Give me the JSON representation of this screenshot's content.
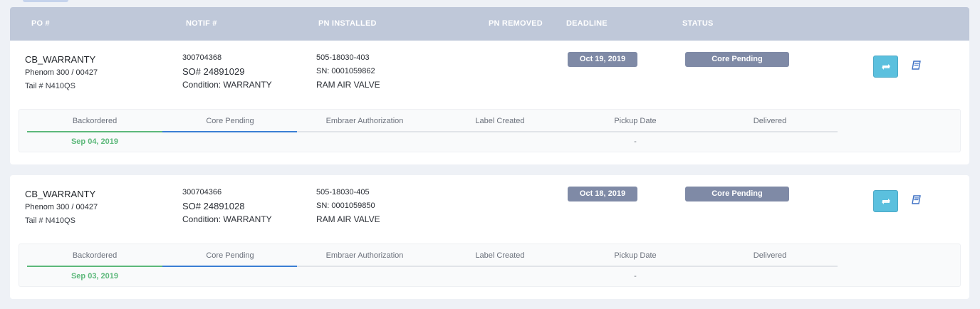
{
  "header": {
    "po": "PO #",
    "notif": "NOTIF #",
    "pn_installed": "PN INSTALLED",
    "pn_removed": "PN REMOVED",
    "deadline": "DEADLINE",
    "status": "STATUS"
  },
  "steps": [
    "Backordered",
    "Core Pending",
    "Embraer Authorization",
    "Label Created",
    "Pickup Date",
    "Delivered"
  ],
  "orders": [
    {
      "po": "CB_WARRANTY",
      "aircraft": "Phenom 300 / 00427",
      "tail": "Tail # N410QS",
      "notif": "300704368",
      "so": "SO# 24891029",
      "condition": "Condition: WARRANTY",
      "pn": "505-18030-403",
      "sn": "SN: 0001059862",
      "description": "RAM AIR VALVE",
      "deadline": "Oct 19, 2019",
      "status": "Core Pending",
      "backordered_date": "Sep 04, 2019",
      "pickup_date": "-"
    },
    {
      "po": "CB_WARRANTY",
      "aircraft": "Phenom 300 / 00427",
      "tail": "Tail # N410QS",
      "notif": "300704366",
      "so": "SO# 24891028",
      "condition": "Condition: WARRANTY",
      "pn": "505-18030-405",
      "sn": "SN: 0001059850",
      "description": "RAM AIR VALVE",
      "deadline": "Oct 18, 2019",
      "status": "Core Pending",
      "backordered_date": "Sep 03, 2019",
      "pickup_date": "-"
    }
  ],
  "icons": {
    "refresh": "refresh-icon",
    "book": "book-icon"
  },
  "colors": {
    "header": "#bfc8d9",
    "badge": "#7f8aa6",
    "refresh_button": "#5bc0de",
    "complete": "#5cb87a",
    "current": "#3b7fd4"
  }
}
